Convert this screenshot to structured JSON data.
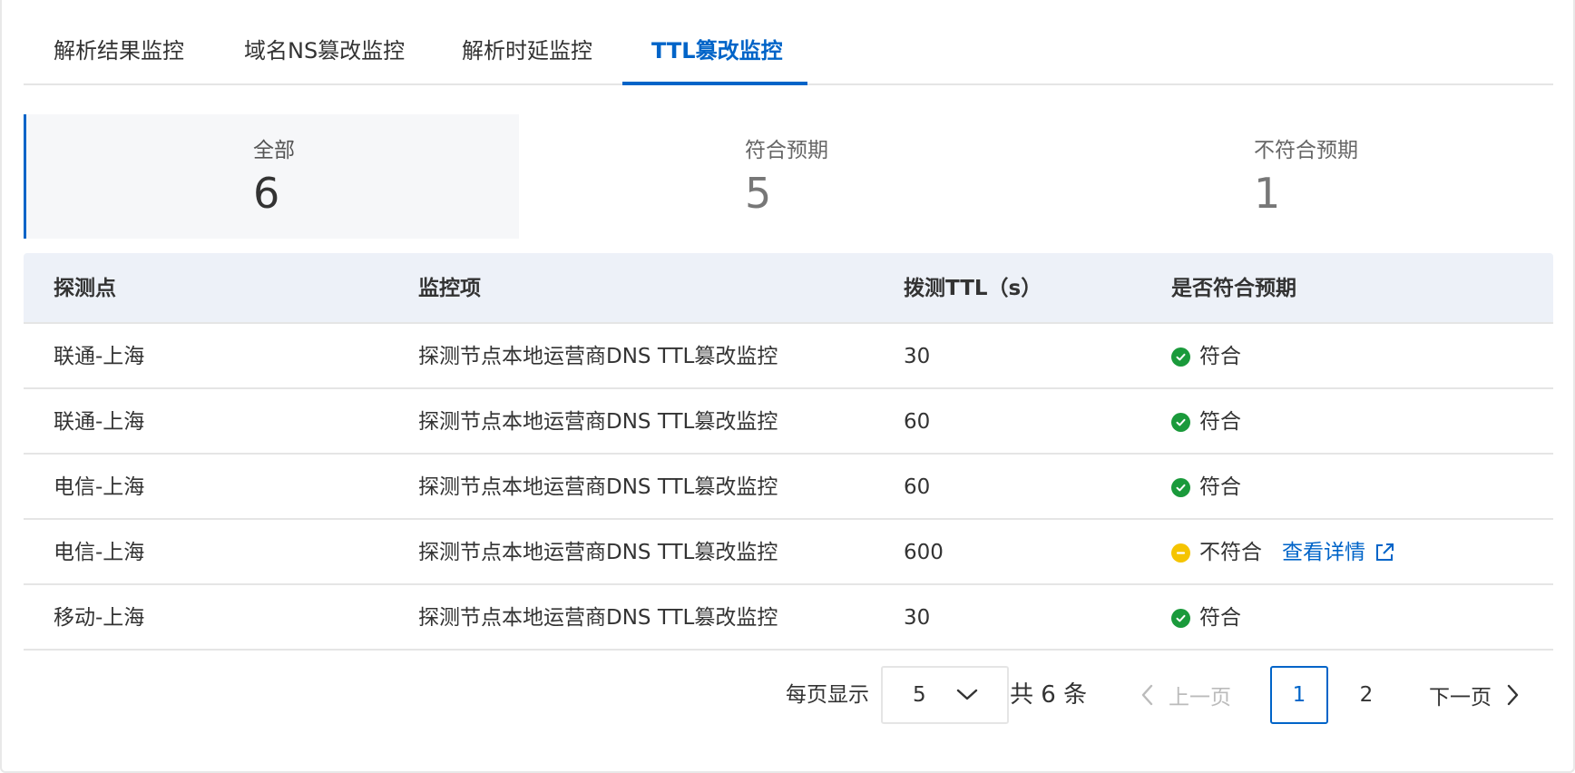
{
  "tabs": [
    {
      "label": "解析结果监控",
      "active": false
    },
    {
      "label": "域名NS篡改监控",
      "active": false
    },
    {
      "label": "解析时延监控",
      "active": false
    },
    {
      "label": "TTL篡改监控",
      "active": true
    }
  ],
  "summary": {
    "all": {
      "label": "全部",
      "value": "6"
    },
    "match": {
      "label": "符合预期",
      "value": "5"
    },
    "mismatch": {
      "label": "不符合预期",
      "value": "1"
    }
  },
  "table": {
    "headers": [
      "探测点",
      "监控项",
      "拨测TTL（s）",
      "是否符合预期"
    ],
    "rows": [
      {
        "probe": "联通-上海",
        "item": "探测节点本地运营商DNS TTL篡改监控",
        "ttl": "30",
        "status": "符合",
        "ok": true
      },
      {
        "probe": "联通-上海",
        "item": "探测节点本地运营商DNS TTL篡改监控",
        "ttl": "60",
        "status": "符合",
        "ok": true
      },
      {
        "probe": "电信-上海",
        "item": "探测节点本地运营商DNS TTL篡改监控",
        "ttl": "60",
        "status": "符合",
        "ok": true
      },
      {
        "probe": "电信-上海",
        "item": "探测节点本地运营商DNS TTL篡改监控",
        "ttl": "600",
        "status": "不符合",
        "ok": false,
        "link": "查看详情"
      },
      {
        "probe": "移动-上海",
        "item": "探测节点本地运营商DNS TTL篡改监控",
        "ttl": "30",
        "status": "符合",
        "ok": true
      }
    ]
  },
  "pagination": {
    "per_page_label": "每页显示",
    "per_page_value": "5",
    "total_label": "共 6 条",
    "prev_label": "上一页",
    "next_label": "下一页",
    "pages": [
      "1",
      "2"
    ],
    "current_page": "1"
  },
  "colors": {
    "accent": "#0064c8",
    "ok": "#1a9a3b",
    "warn": "#f5c400"
  },
  "icons": {
    "ok": "check-circle-icon",
    "warn": "minus-circle-icon",
    "external": "external-link-icon",
    "chevron_down": "chevron-down-icon",
    "chevron_left": "chevron-left-icon",
    "chevron_right": "chevron-right-icon"
  }
}
